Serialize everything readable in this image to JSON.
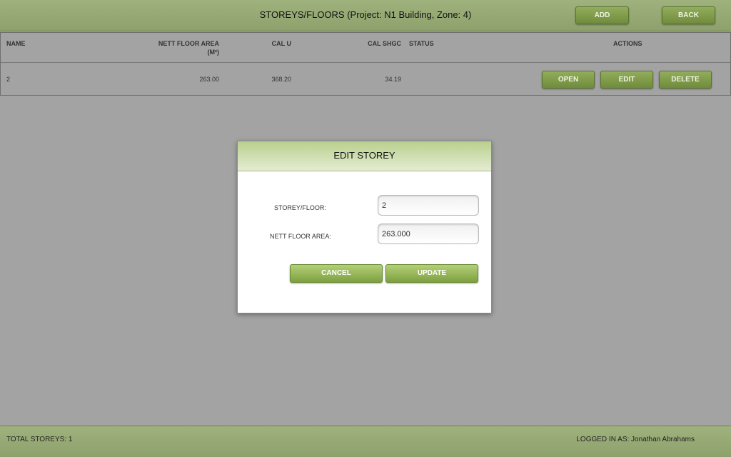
{
  "header": {
    "title": "STOREYS/FLOORS (Project: N1 Building, Zone: 4)",
    "add_label": "ADD",
    "back_label": "BACK"
  },
  "table": {
    "columns": {
      "name": "NAME",
      "nett_floor_area": "NETT FLOOR AREA",
      "nett_floor_area_unit": "(M²)",
      "cal_u": "CAL U",
      "cal_shgc": "CAL SHGC",
      "status": "STATUS",
      "actions": "ACTIONS"
    },
    "rows": [
      {
        "name": "2",
        "nett_floor_area": "263.00",
        "cal_u": "368.20",
        "cal_shgc": "34.19",
        "status": "",
        "open_label": "OPEN",
        "edit_label": "EDIT",
        "delete_label": "DELETE"
      }
    ]
  },
  "modal": {
    "title": "EDIT STOREY",
    "storey_label": "STOREY/FLOOR:",
    "storey_value": "2",
    "area_label": "NETT FLOOR AREA:",
    "area_value": "263.000",
    "cancel_label": "CANCEL",
    "update_label": "UPDATE"
  },
  "footer": {
    "total": "TOTAL STOREYS: 1",
    "logged_in": "LOGGED IN AS: Jonathan Abrahams"
  },
  "colors": {
    "header_green": "#9fb27d",
    "button_green": "#7e9a4a",
    "modal_button_green": "#9dbd5c",
    "backdrop_gray": "#a3a3a3"
  }
}
